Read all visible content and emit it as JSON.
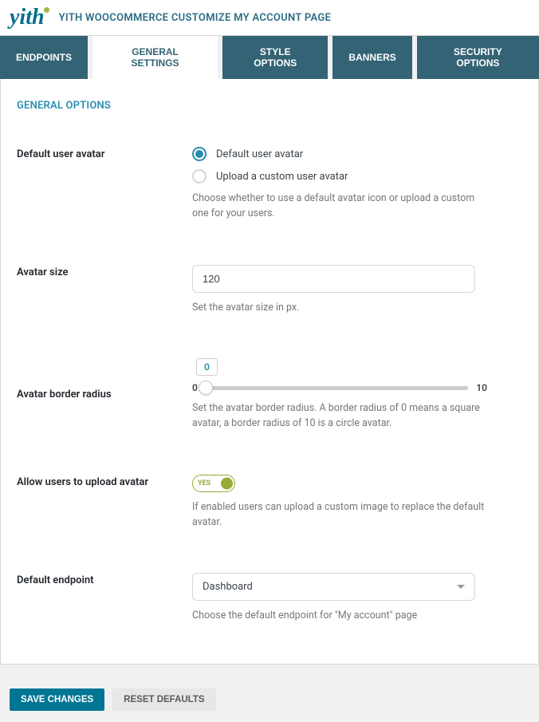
{
  "header": {
    "logo_text": "yith",
    "title": "YITH WOOCOMMERCE CUSTOMIZE MY ACCOUNT PAGE"
  },
  "tabs": [
    {
      "label": "ENDPOINTS",
      "active": false
    },
    {
      "label": "GENERAL SETTINGS",
      "active": true
    },
    {
      "label": "STYLE OPTIONS",
      "active": false
    },
    {
      "label": "BANNERS",
      "active": false
    },
    {
      "label": "SECURITY OPTIONS",
      "active": false
    }
  ],
  "section": {
    "title": "GENERAL OPTIONS"
  },
  "fields": {
    "default_avatar": {
      "label": "Default user avatar",
      "options": [
        {
          "label": "Default user avatar",
          "checked": true
        },
        {
          "label": "Upload a custom user avatar",
          "checked": false
        }
      ],
      "desc": "Choose whether to use a default avatar icon or upload a custom one for your users."
    },
    "avatar_size": {
      "label": "Avatar size",
      "value": "120",
      "desc": "Set the avatar size in px."
    },
    "border_radius": {
      "label": "Avatar border radius",
      "value": "0",
      "min": "0",
      "max": "10",
      "desc": "Set the avatar border radius. A border radius of 0 means a square avatar, a border radius of 10 is a circle avatar."
    },
    "allow_upload": {
      "label": "Allow users to upload avatar",
      "toggle_text": "YES",
      "desc": "If enabled users can upload a custom image to replace the default avatar."
    },
    "default_endpoint": {
      "label": "Default endpoint",
      "value": "Dashboard",
      "desc": "Choose the default endpoint for \"My account\" page"
    }
  },
  "footer": {
    "save": "SAVE CHANGES",
    "reset": "RESET DEFAULTS"
  }
}
